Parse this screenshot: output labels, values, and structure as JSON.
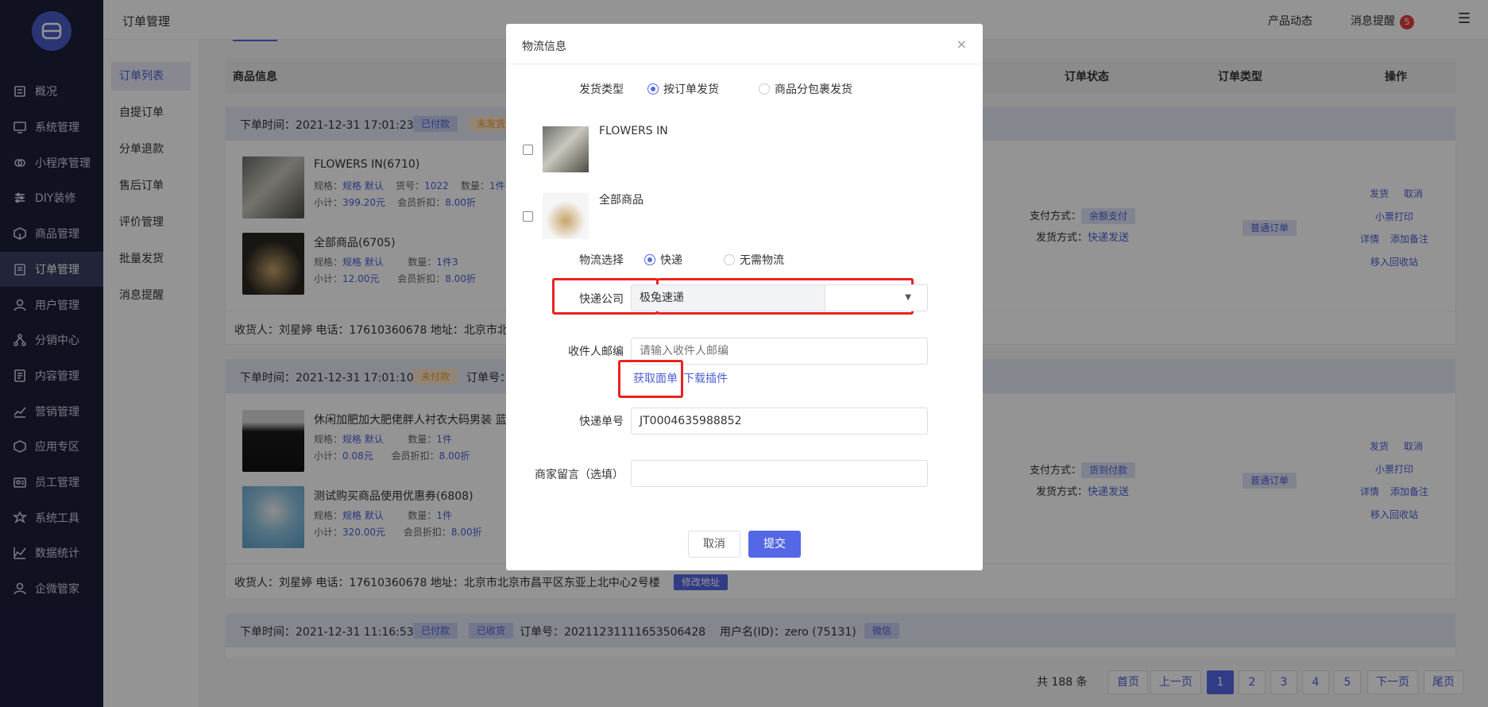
{
  "topbar": {
    "title": "订单管理",
    "product_news": "产品动态",
    "messages": "消息提醒",
    "message_count": "5"
  },
  "sidebar": {
    "items": [
      {
        "label": "概况",
        "icon": "overview-icon"
      },
      {
        "label": "系统管理",
        "icon": "system-icon"
      },
      {
        "label": "小程序管理",
        "icon": "miniprogram-icon"
      },
      {
        "label": "DIY装修",
        "icon": "sliders-icon"
      },
      {
        "label": "商品管理",
        "icon": "box-icon"
      },
      {
        "label": "订单管理",
        "icon": "clipboard-icon"
      },
      {
        "label": "用户管理",
        "icon": "user-icon"
      },
      {
        "label": "分销中心",
        "icon": "network-icon"
      },
      {
        "label": "内容管理",
        "icon": "document-icon"
      },
      {
        "label": "营销管理",
        "icon": "chart-icon"
      },
      {
        "label": "应用专区",
        "icon": "cube-icon"
      },
      {
        "label": "员工管理",
        "icon": "id-card-icon"
      },
      {
        "label": "系统工具",
        "icon": "tool-icon"
      },
      {
        "label": "数据统计",
        "icon": "line-chart-icon"
      },
      {
        "label": "企微管家",
        "icon": "wecom-icon"
      }
    ]
  },
  "subnav": {
    "items": [
      "订单列表",
      "自提订单",
      "分单退款",
      "售后订单",
      "评价管理",
      "批量发货",
      "消息提醒"
    ]
  },
  "table": {
    "headers": {
      "product": "商品信息",
      "status": "订单状态",
      "type": "订单类型",
      "action": "操作"
    }
  },
  "orders": [
    {
      "time": "下单时间：2021-12-31 17:01:23",
      "tag1": "已付款",
      "tag2": "未发货",
      "products": [
        {
          "name": "FLOWERS IN(6710)",
          "spec_label": "规格：",
          "spec": "规格  默认",
          "sku_label": "货号：",
          "sku": "1022",
          "qty_label": "数量：",
          "qty": "1件",
          "subtotal_label": "小计：",
          "subtotal": "399.20元",
          "discount_label": "会员折扣：",
          "discount": "8.00折"
        },
        {
          "name": "全部商品(6705)",
          "spec_label": "规格：",
          "spec": "规格  默认",
          "qty_label": "数量：",
          "qty": "1件3",
          "subtotal_label": "小计：",
          "subtotal": "12.00元",
          "discount_label": "会员折扣：",
          "discount": "8.00折"
        }
      ],
      "consignee": "收货人：刘星婷   电话：17610360678   地址：北京市北",
      "pay_label": "支付方式：",
      "pay": "余额支付",
      "ship_label": "发货方式：",
      "ship": "快递发送",
      "type": "普通订单",
      "actions": [
        "发货",
        "取消",
        "小票打印",
        "详情",
        "添加备注",
        "移入回收站"
      ]
    },
    {
      "time": "下单时间：2021-12-31 17:01:10",
      "tag1": "未付款",
      "order_no": "订单号：",
      "products": [
        {
          "name": "休闲加肥加大肥佬胖人衬衣大码男装 蓝",
          "spec_label": "规格：",
          "spec": "规格  默认",
          "qty_label": "数量：",
          "qty": "1件",
          "subtotal_label": "小计：",
          "subtotal": "0.08元",
          "discount_label": "会员折扣：",
          "discount": "8.00折"
        },
        {
          "name": "测试购买商品使用优惠券(6808)",
          "spec_label": "规格：",
          "spec": "规格  默认",
          "qty_label": "数量：",
          "qty": "1件",
          "subtotal_label": "小计：",
          "subtotal": "320.00元",
          "discount_label": "会员折扣：",
          "discount": "8.00折"
        }
      ],
      "consignee": "收货人：刘星婷   电话：17610360678   地址：北京市北京市昌平区东亚上北中心2号楼",
      "modify": "修改地址",
      "pay_label": "支付方式：",
      "pay": "货到付款",
      "ship_label": "发货方式：",
      "ship": "快递发送",
      "type": "普通订单",
      "actions": [
        "发货",
        "取消",
        "小票打印",
        "详情",
        "添加备注",
        "移入回收站"
      ]
    },
    {
      "time": "下单时间：2021-12-31 11:16:53",
      "tag1": "已付款",
      "tag2": "已收货",
      "order_no": "订单号：20211231111653506428",
      "user": "用户名(ID)：zero (75131)",
      "channel": "微信"
    }
  ],
  "pagination": {
    "total": "共 188 条",
    "first": "首页",
    "prev": "上一页",
    "pages": [
      "1",
      "2",
      "3",
      "4",
      "5"
    ],
    "next": "下一页",
    "last": "尾页"
  },
  "modal": {
    "title": "物流信息",
    "close": "×",
    "ship_type_label": "发货类型",
    "ship_type_options": [
      "按订单发货",
      "商品分包裹发货"
    ],
    "items": [
      "FLOWERS IN",
      "全部商品"
    ],
    "logistics_label": "物流选择",
    "logistics_options": [
      "快递",
      "无需物流"
    ],
    "courier_label": "快递公司",
    "courier_value": "极兔速递",
    "zip_label": "收件人邮编",
    "zip_placeholder": "请输入收件人邮编",
    "get_waybill": "获取面单",
    "download_plugin": "下载插件",
    "tracking_label": "快递单号",
    "tracking_value": "JT0004635988852",
    "note_label": "商家留言（选填）",
    "cancel": "取消",
    "submit": "提交"
  }
}
